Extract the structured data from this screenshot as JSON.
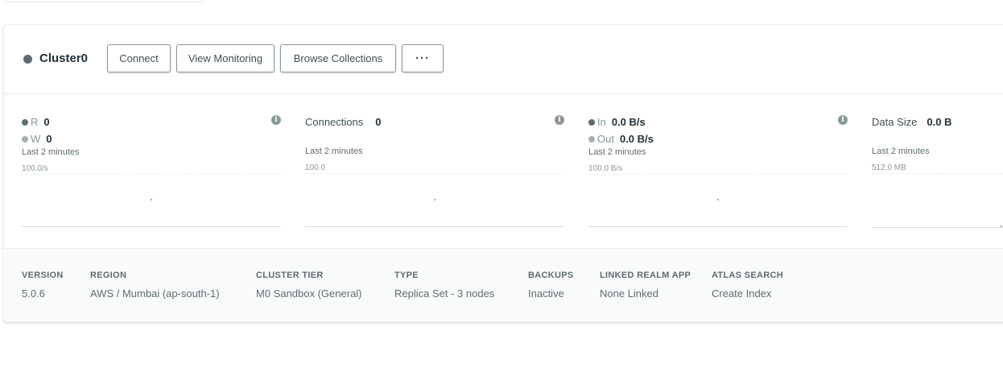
{
  "cluster": {
    "name": "Cluster0",
    "status_color": "#5d6c74",
    "buttons": {
      "connect": "Connect",
      "view_monitoring": "View Monitoring",
      "browse_collections": "Browse Collections",
      "more": "···"
    }
  },
  "metrics": {
    "ops": {
      "r_label": "R",
      "r_value": "0",
      "w_label": "W",
      "w_value": "0",
      "period": "Last 2 minutes",
      "scale": "100.0/s",
      "icon": "info-icon"
    },
    "connections": {
      "label": "Connections",
      "value": "0",
      "period": "Last 2 minutes",
      "scale": "100.0",
      "icon": "info-icon"
    },
    "network": {
      "in_label": "In",
      "in_value": "0.0 B/s",
      "out_label": "Out",
      "out_value": "0.0 B/s",
      "period": "Last 2 minutes",
      "scale": "100.0 B/s",
      "icon": "info-icon"
    },
    "data_size": {
      "label": "Data Size",
      "value": "0.0 B",
      "period": "Last 2 minutes",
      "scale": "512.0 MB"
    }
  },
  "details": [
    {
      "heading": "VERSION",
      "value": "5.0.6"
    },
    {
      "heading": "REGION",
      "value": "AWS / Mumbai (ap-south-1)"
    },
    {
      "heading": "CLUSTER TIER",
      "value": "M0 Sandbox (General)"
    },
    {
      "heading": "TYPE",
      "value": "Replica Set - 3 nodes"
    },
    {
      "heading": "BACKUPS",
      "value": "Inactive"
    },
    {
      "heading": "LINKED REALM APP",
      "value": "None Linked"
    },
    {
      "heading": "ATLAS SEARCH",
      "value": "Create Index"
    }
  ]
}
